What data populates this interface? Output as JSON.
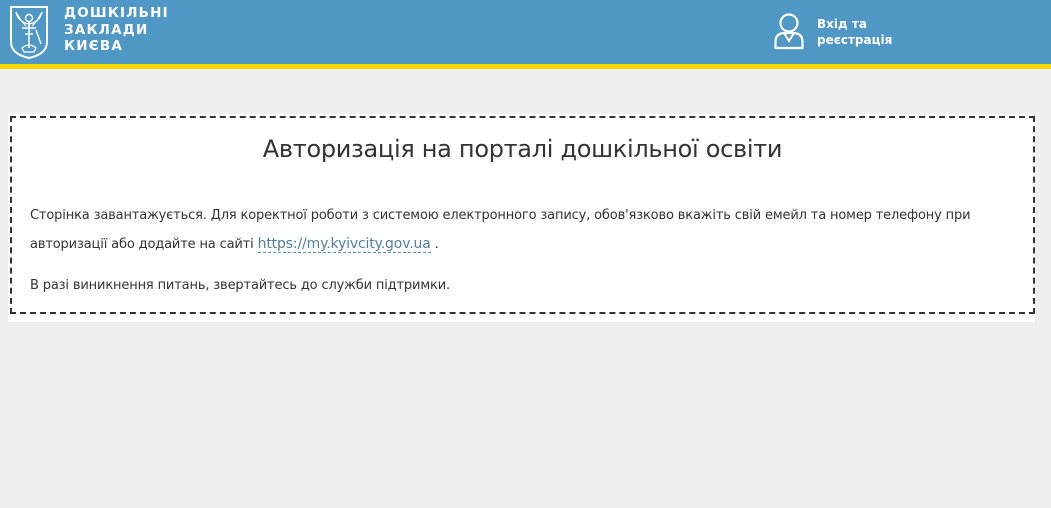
{
  "header": {
    "logo_lines": [
      "ДОШКІЛЬНІ",
      "ЗАКЛАДИ",
      "КИЄВА"
    ],
    "login_line1": "Вхід та",
    "login_line2": "реєстрація",
    "login_icon": "user-icon",
    "emblem_icon": "kyiv-coat-of-arms-icon"
  },
  "main": {
    "title": "Авторизація на порталі дошкільної освіти",
    "paragraph1_before": "Сторінка завантажується. Для коректної роботи з системою електронного запису, обов'язково вкажіть свій емейл та номер телефону при авторизації або додайте на сайті ",
    "link_text": "https://my.kyivcity.gov.ua",
    "paragraph1_after": " .",
    "paragraph2": "В разі виникнення питань, звертайтесь до служби підтримки."
  },
  "colors": {
    "header_bg": "#4f97c5",
    "header_stripe": "#ffd800",
    "page_bg": "#efefef",
    "panel_bg": "#ffffff",
    "text": "#333333",
    "link": "#4f7f9e"
  }
}
